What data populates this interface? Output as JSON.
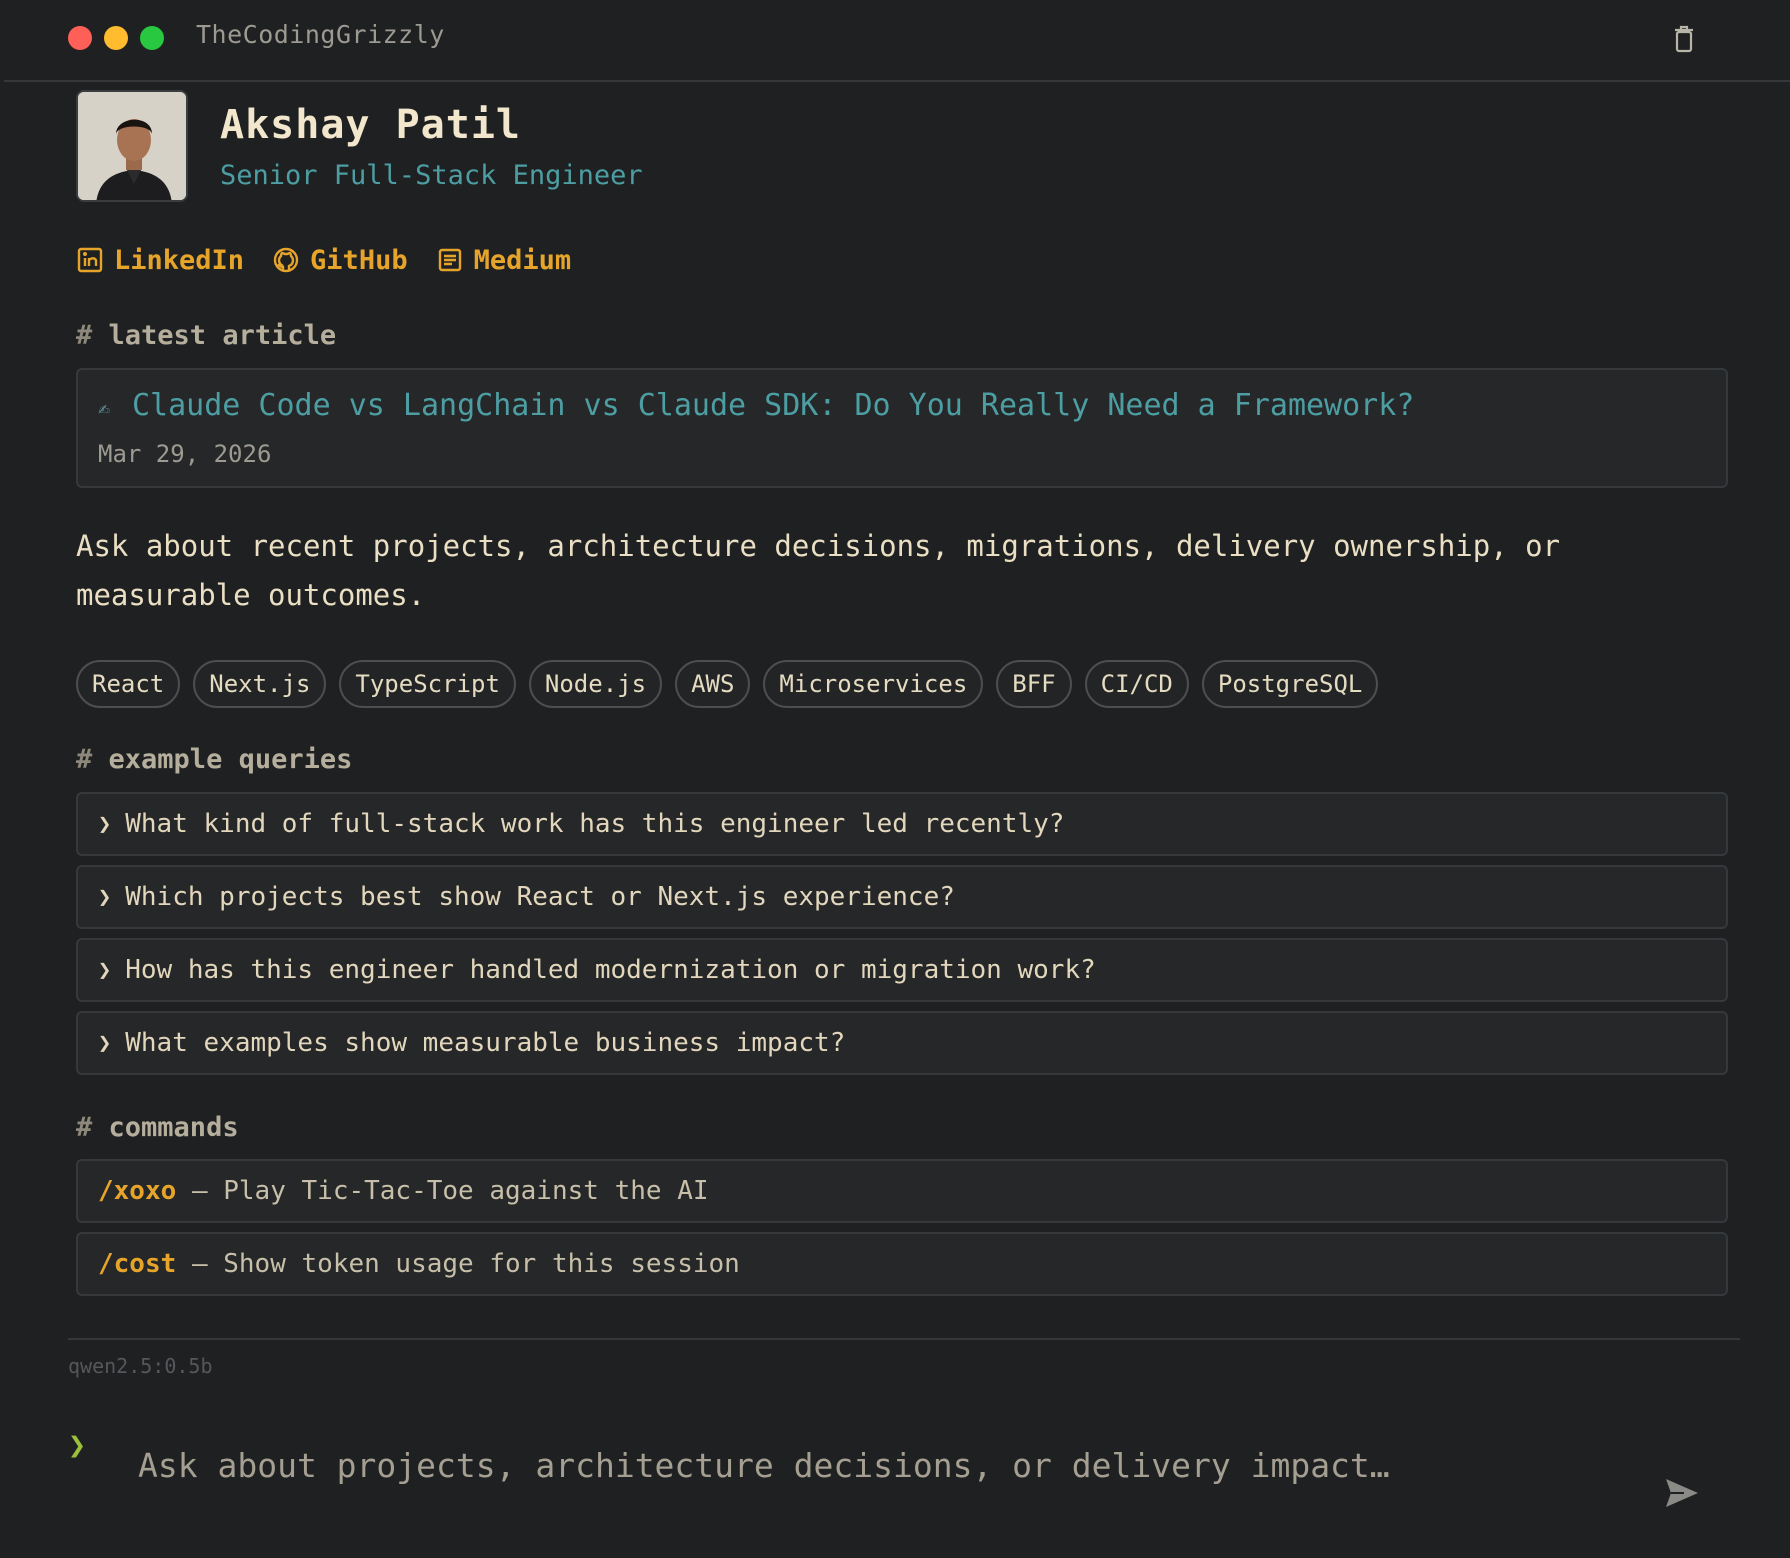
{
  "window": {
    "title": "TheCodingGrizzly"
  },
  "profile": {
    "name": "Akshay Patil",
    "role": "Senior Full-Stack Engineer"
  },
  "links": [
    {
      "label": "LinkedIn",
      "icon": "linkedin-icon"
    },
    {
      "label": "GitHub",
      "icon": "github-icon"
    },
    {
      "label": "Medium",
      "icon": "document-icon"
    }
  ],
  "sections": {
    "latest_article": "latest article",
    "example_queries": "example queries",
    "commands": "commands"
  },
  "article": {
    "title": "Claude Code vs LangChain vs Claude SDK: Do You Really Need a Framework?",
    "date": "Mar 29, 2026"
  },
  "intro": "Ask about recent projects, architecture decisions, migrations, delivery ownership, or measurable outcomes.",
  "tags": [
    "React",
    "Next.js",
    "TypeScript",
    "Node.js",
    "AWS",
    "Microservices",
    "BFF",
    "CI/CD",
    "PostgreSQL"
  ],
  "queries": [
    "What kind of full-stack work has this engineer led recently?",
    "Which projects best show React or Next.js experience?",
    "How has this engineer handled modernization or migration work?",
    "What examples show measurable business impact?"
  ],
  "commands": [
    {
      "cmd": "/xoxo",
      "desc": "— Play Tic-Tac-Toe against the AI"
    },
    {
      "cmd": "/cost",
      "desc": "— Show token usage for this session"
    }
  ],
  "footer": {
    "model": "qwen2.5:0.5b",
    "placeholder": "Ask about projects, architecture decisions, or delivery impact…"
  },
  "colors": {
    "accent": "#e6a52a",
    "link_teal": "#4d9ea3",
    "prompt_green": "#9bbf3a",
    "background": "#1e2022"
  }
}
